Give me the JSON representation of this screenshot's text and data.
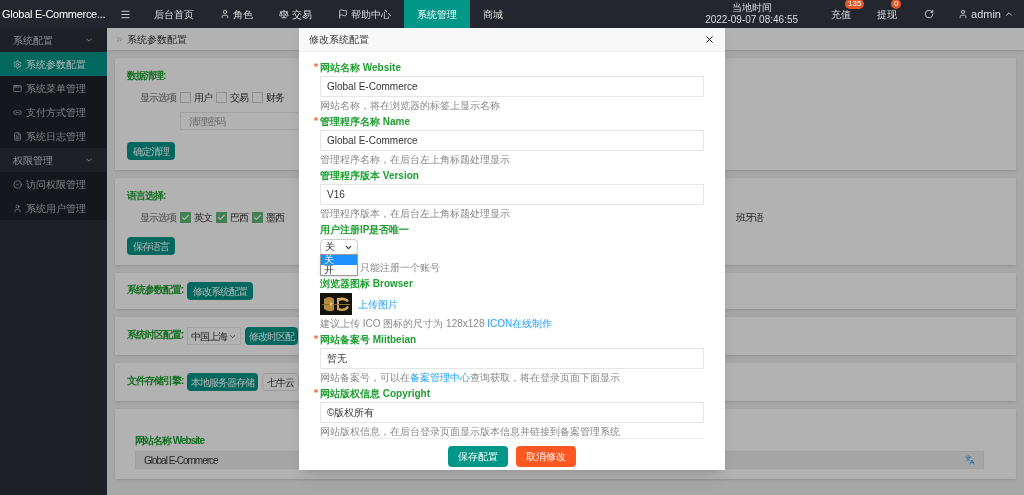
{
  "top_bar": {
    "logo": "Global E-Commerce...",
    "nav": [
      {
        "label": "后台首页",
        "selected": false
      },
      {
        "label": "角色",
        "selected": false
      },
      {
        "label": "交易",
        "selected": false
      },
      {
        "label": "帮助中心",
        "selected": false
      },
      {
        "label": "系统管理",
        "selected": true
      },
      {
        "label": "商城",
        "selected": false
      }
    ],
    "clock": {
      "label": "当地时间",
      "time": "2022-09-07 08:46:55"
    },
    "actions": [
      {
        "label": "充值",
        "badge": "135"
      },
      {
        "label": "提现",
        "badge": "0"
      }
    ],
    "user": "admin"
  },
  "sidebar": [
    {
      "label": "系统配置",
      "expanded": true,
      "children": [
        {
          "label": "系统参数配置",
          "selected": true
        },
        {
          "label": "系统菜单管理",
          "selected": false
        },
        {
          "label": "支付方式管理",
          "selected": false
        },
        {
          "label": "系统日志管理",
          "selected": false
        }
      ]
    },
    {
      "label": "权限管理",
      "expanded": true,
      "children": [
        {
          "label": "访问权限管理",
          "selected": false
        },
        {
          "label": "系统用户管理",
          "selected": false
        }
      ]
    }
  ],
  "breadcrumb": "系统参数配置",
  "cards": [
    {
      "kind": "cleanup",
      "title": "数据清理:",
      "options_label": "显示选项",
      "options": [
        {
          "label": "用户",
          "checked": false
        },
        {
          "label": "交易",
          "checked": false
        },
        {
          "label": "财务",
          "checked": false
        }
      ],
      "password_placeholder": "清理密码",
      "button": "确定清理"
    },
    {
      "kind": "language",
      "title": "语言选择:",
      "options_label": "显示选项",
      "options": [
        {
          "label": "英文",
          "checked": true
        },
        {
          "label": "巴西",
          "checked": true
        },
        {
          "label": "墨西",
          "checked": true
        }
      ],
      "trailing": "班牙语",
      "button": "保存语言"
    },
    {
      "kind": "action",
      "title": "系统参数配置:",
      "button": "修改系统配置"
    },
    {
      "kind": "timezone",
      "title": "系统时区配置:",
      "select": "中国上海",
      "button": "修改时区配"
    },
    {
      "kind": "storage",
      "title": "文件存储引擎:",
      "options": [
        {
          "label": "本地服务器存储",
          "selected": true
        },
        {
          "label": "七牛云",
          "selected": false
        }
      ]
    },
    {
      "kind": "field",
      "label": "网站名称 Website",
      "value": "Global E-Commerce"
    }
  ],
  "modal": {
    "title": "修改系统配置",
    "fields": [
      {
        "kind": "text",
        "label": "网站名称 Website",
        "required": true,
        "value": "Global E-Commerce",
        "help": [
          {
            "text": "网站名称，将在浏览器的标签上显示名称",
            "link": false
          }
        ]
      },
      {
        "kind": "text",
        "label": "管理程序名称 Name",
        "required": true,
        "value": "Global E-Commerce",
        "help": [
          {
            "text": "管理程序名称，在后台左上角标题处理显示",
            "link": false
          }
        ]
      },
      {
        "kind": "text",
        "label": "管理程序版本 Version",
        "required": false,
        "value": "V16",
        "help": [
          {
            "text": "管理程序版本，在后台左上角标题处理显示",
            "link": false
          }
        ]
      },
      {
        "kind": "select",
        "label": "用户注册IP是否唯一",
        "required": false,
        "value": "关",
        "options": [
          {
            "label": "关",
            "selected": true
          },
          {
            "label": "开",
            "selected": false
          }
        ],
        "help": [
          {
            "text": "只能注册一个账号",
            "link": false
          }
        ]
      },
      {
        "label": "浏览器图标 Browser",
        "required": false,
        "upload": "上传图片",
        "help": [
          {
            "text": "建议上传 ICO 图标的尺寸为 128x128 ",
            "link": false
          },
          {
            "text": "ICON在线制作",
            "link": true
          }
        ]
      },
      {
        "kind": "text",
        "label": "网站备案号 Miitbeian",
        "required": true,
        "value": "暂无",
        "help": [
          {
            "text": "网站备案号，可以在",
            "link": false
          },
          {
            "text": "备案管理中心",
            "link": true
          },
          {
            "text": "查询获取，将在登录页面下面显示",
            "link": false
          }
        ]
      },
      {
        "kind": "text",
        "label": "网站版权信息 Copyright",
        "required": true,
        "value": "©版权所有",
        "help": [
          {
            "text": "网站版权信息，在后台登录页面显示版本信息并链接到备案管理系统",
            "link": false
          }
        ]
      }
    ],
    "buttons": [
      {
        "label": "保存配置",
        "kind": "primary"
      },
      {
        "label": "取消修改",
        "kind": "danger"
      }
    ]
  }
}
